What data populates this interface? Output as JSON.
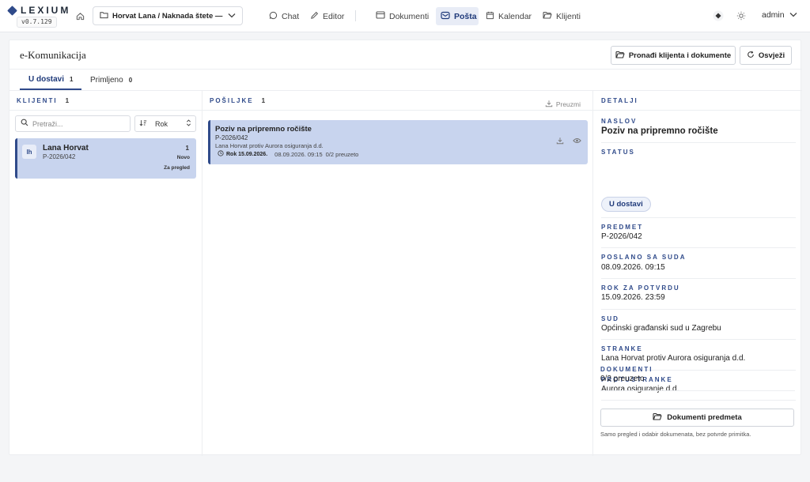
{
  "app": {
    "logo_text": "LEXIUM",
    "version": "v0.7.129"
  },
  "topbar": {
    "case_selector": "Horvat Lana / Naknada štete — ...",
    "nav": {
      "chat": "Chat",
      "editor": "Editor",
      "documents": "Dokumenti",
      "mail": "Pošta",
      "calendar": "Kalendar",
      "clients": "Klijenti"
    },
    "active_nav": "Pošta",
    "user": "admin"
  },
  "page": {
    "title": "e-Komunikacija",
    "find_client_button": "Pronađi klijenta i dokumente",
    "refresh_button": "Osvježi"
  },
  "tabs": [
    {
      "label": "U dostavi",
      "count": "1"
    },
    {
      "label": "Primljeno",
      "count": "0"
    }
  ],
  "clients_panel": {
    "heading": "KLIJENTI",
    "count": "1",
    "search_placeholder": "Pretraži...",
    "sort_label": "Rok",
    "items": [
      {
        "initials": "lh",
        "name": "Lana Horvat",
        "case": "P-2026/042",
        "count": "1",
        "badge_new": "Novo",
        "badge_review": "Za pregled"
      }
    ]
  },
  "messages_panel": {
    "heading": "POŠILJKE",
    "count": "1",
    "download_label": "Preuzmi",
    "items": [
      {
        "title": "Poziv na pripremno ročište",
        "case": "P-2026/042",
        "parties": "Lana Horvat protiv Aurora osiguranja d.d.",
        "deadline": "Rok 15.09.2026.",
        "sent": "08.09.2026. 09:15",
        "downloaded": "0/2 preuzeto"
      }
    ]
  },
  "details": {
    "heading": "DETALJI",
    "fields": {
      "subject_label": "NASLOV",
      "subject": "Poziv na pripremno ročište",
      "status_label": "STATUS",
      "status": "U dostavi",
      "case_label": "PREDMET",
      "case": "P-2026/042",
      "sent_label": "POSLANO SA SUDA",
      "sent": "08.09.2026. 09:15",
      "deadline_label": "ROK ZA POTVRDU",
      "deadline": "15.09.2026. 23:59",
      "court_label": "SUD",
      "court": "Općinski građanski sud u Zagrebu",
      "parties_label": "STRANKE",
      "parties": "Lana Horvat protiv Aurora osiguranja d.d.",
      "opposing_label": "PROTUSTRANKE",
      "opposing": "Aurora osiguranje d.d.",
      "documents_label": "DOKUMENTI",
      "documents": "0/2 preuzeto"
    },
    "case_documents_button": "Dokumenti predmeta",
    "note": "Samo pregled i odabir dokumenata, bez potvrde primitka."
  },
  "colors": {
    "accent": "#2f4a8a",
    "selected_bg": "#c8d4ee",
    "active_nav_bg": "#e8ecf6"
  }
}
